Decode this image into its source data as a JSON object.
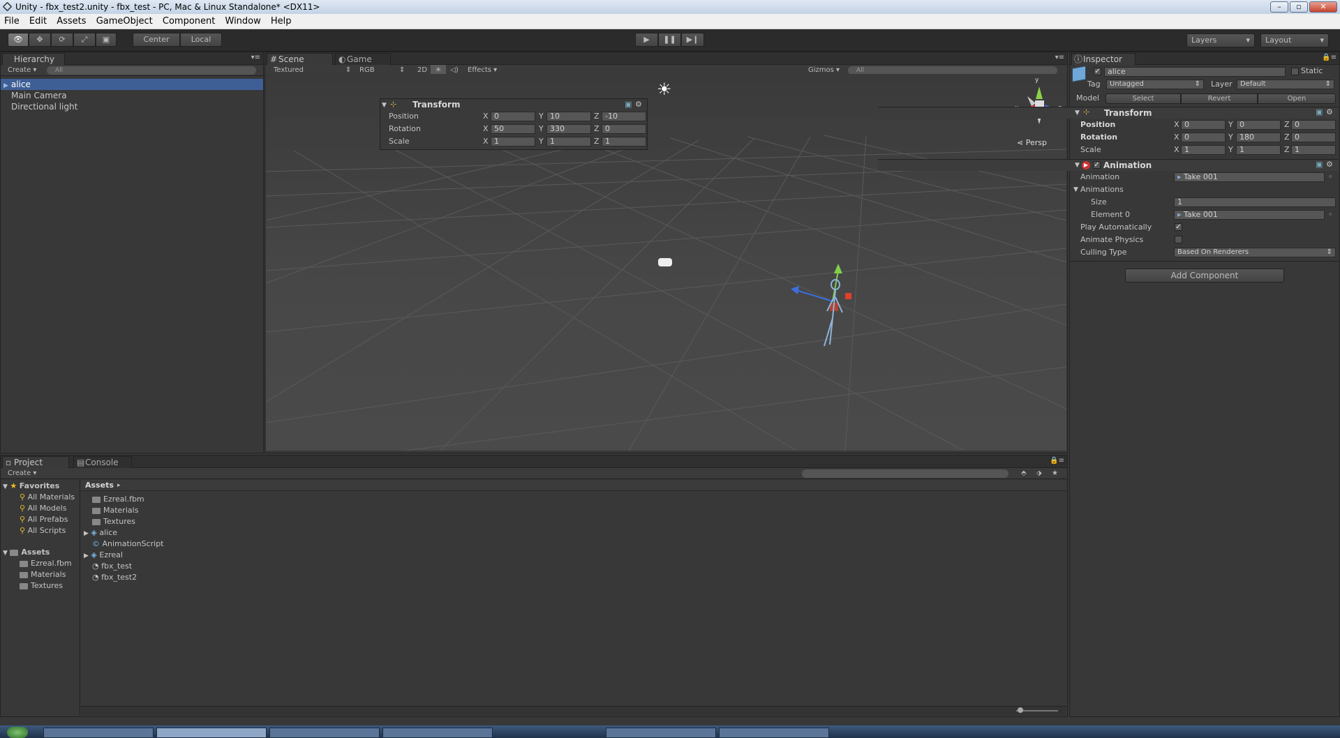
{
  "window": {
    "title": "Unity - fbx_test2.unity - fbx_test - PC, Mac & Linux Standalone* <DX11>"
  },
  "menu": [
    "File",
    "Edit",
    "Assets",
    "GameObject",
    "Component",
    "Window",
    "Help"
  ],
  "toolbar": {
    "pivot": "Center",
    "space": "Local",
    "layers": "Layers",
    "layout": "Layout"
  },
  "hierarchy": {
    "tab": "Hierarchy",
    "create": "Create",
    "search_placeholder": "All",
    "items": [
      "alice",
      "Main Camera",
      "Directional light"
    ]
  },
  "scene": {
    "tabs": [
      "Scene",
      "Game"
    ],
    "shading": "Textured",
    "channel": "RGB",
    "mode_2d": "2D",
    "effects": "Effects",
    "gizmos": "Gizmos",
    "search_placeholder": "All",
    "persp": "Persp",
    "axis_y": "y",
    "axis_x": "x",
    "axis_z": "z"
  },
  "transform_overlay": {
    "title": "Transform",
    "rows": [
      {
        "label": "Position",
        "x": "0",
        "y": "10",
        "z": "-10"
      },
      {
        "label": "Rotation",
        "x": "50",
        "y": "330",
        "z": "0"
      },
      {
        "label": "Scale",
        "x": "1",
        "y": "1",
        "z": "1"
      }
    ]
  },
  "inspector": {
    "tab": "Inspector",
    "object_name": "alice",
    "static_label": "Static",
    "tag_label": "Tag",
    "tag_value": "Untagged",
    "layer_label": "Layer",
    "layer_value": "Default",
    "model_label": "Model",
    "model_buttons": [
      "Select",
      "Revert",
      "Open"
    ],
    "transform": {
      "title": "Transform",
      "rows": [
        {
          "label": "Position",
          "x": "0",
          "y": "0",
          "z": "0"
        },
        {
          "label": "Rotation",
          "x": "0",
          "y": "180",
          "z": "0"
        },
        {
          "label": "Scale",
          "x": "1",
          "y": "1",
          "z": "1"
        }
      ]
    },
    "animation": {
      "title": "Animation",
      "animation_label": "Animation",
      "animation_value": "Take 001",
      "animations_label": "Animations",
      "size_label": "Size",
      "size_value": "1",
      "element_label": "Element 0",
      "element_value": "Take 001",
      "play_auto_label": "Play Automatically",
      "play_auto": true,
      "animate_physics_label": "Animate Physics",
      "animate_physics": false,
      "culling_label": "Culling Type",
      "culling_value": "Based On Renderers"
    },
    "add_component": "Add Component"
  },
  "project": {
    "tabs": [
      "Project",
      "Console"
    ],
    "create": "Create",
    "favorites_label": "Favorites",
    "favorites": [
      "All Materials",
      "All Models",
      "All Prefabs",
      "All Scripts"
    ],
    "assets_label": "Assets",
    "asset_folders": [
      "Ezreal.fbm",
      "Materials",
      "Textures"
    ],
    "breadcrumb": "Assets",
    "files": [
      "Ezreal.fbm",
      "Materials",
      "Textures",
      "alice",
      "AnimationScript",
      "Ezreal",
      "fbx_test",
      "fbx_test2"
    ]
  },
  "colors": {
    "selection": "#3e5f96",
    "panel": "#383838",
    "scene_bg": "#474747"
  }
}
